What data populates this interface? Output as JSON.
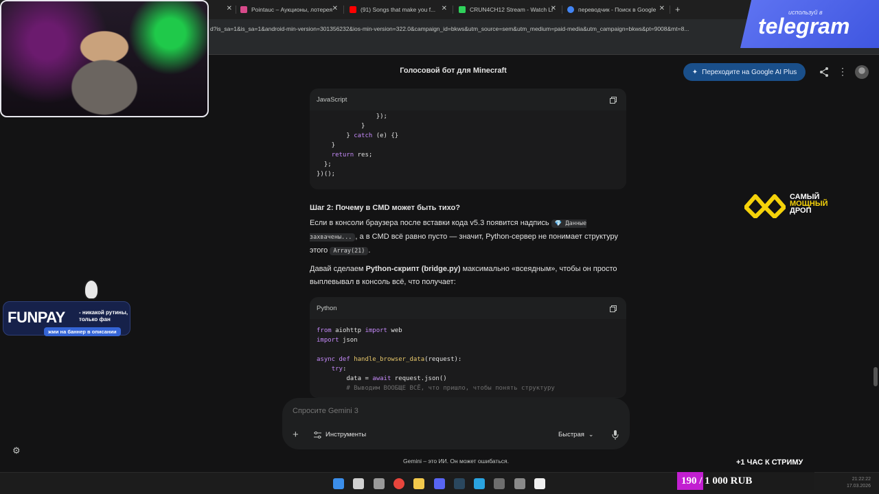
{
  "browser": {
    "tabs": [
      {
        "label": "",
        "color": "#3c3c3c"
      },
      {
        "label": "Pointauc – Аукционы, лотерея",
        "color": "#d84a8a"
      },
      {
        "label": "(91) Songs that make you f...",
        "color": "#ff0000"
      },
      {
        "label": "CRUN4CH12 Stream - Watch Li",
        "color": "#2fd15b"
      },
      {
        "label": "переводчик - Поиск в Google",
        "color": "#4285f4"
      }
    ],
    "url": "d?is_sa=1&is_sa=1&android-min-version=301356232&ios-min-version=322.0&campaign_id=bkws&utm_source=sem&utm_medium=paid-media&utm_campaign=bkws&pt=9008&mt=8..."
  },
  "header": {
    "title": "Голосовой бот для Minecraft",
    "upgrade_label": "Переходите на Google AI Plus"
  },
  "code1": {
    "lang": "JavaScript",
    "lines": [
      "                });",
      "            }",
      "        } catch (e) {}",
      "    }",
      "    return res;",
      "  };",
      "})();"
    ]
  },
  "answer": {
    "step_heading": "Шаг 2: Почему в CMD может быть тихо?",
    "p1_start": "Если в консоли браузера после вставки кода v5.3 появится надпись",
    "p1_code": "💎 Данные захвачены...",
    "p1_mid": ", а в CMD всё равно пусто — значит, Python-сервер не понимает структуру этого",
    "p1_code2": "Array(21)",
    "p1_end": ".",
    "p2_start": "Давай сделаем",
    "p2_bold": "Python-скрипт (bridge.py)",
    "p2_end": "максимально «всеядным», чтобы он просто выплевывал в консоль всё, что получает:"
  },
  "code2": {
    "lang": "Python",
    "lines": [
      "from aiohttp import web",
      "import json",
      "",
      "async def handle_browser_data(request):",
      "    try:",
      "        data = await request.json()",
      "        # Выводим ВООБЩЕ ВСЁ, что пришло, чтобы понять структуру"
    ]
  },
  "composer": {
    "placeholder": "Спросите Gemini 3",
    "tools_label": "Инструменты",
    "mode_label": "Быстрая"
  },
  "disclaimer": "Gemini – это ИИ. Он может ошибаться.",
  "overlays": {
    "telegram_small": "используй в",
    "telegram_big": "telegram",
    "drop_text": [
      "самый",
      "мощный",
      "дроп"
    ],
    "funpay_logo": "FUNPAY",
    "funpay_tag": "- никакой рутины, только фан",
    "funpay_cta": "жми на баннер в описании",
    "stream_timer": "+1 ЧАС К СТРИМУ",
    "donate_text": "190 / 1 000 RUB",
    "donate_progress": 0.19
  },
  "taskbar": {
    "clock_time": "21:22:22",
    "clock_date": "17.03.2026",
    "icons": [
      "windows-icon",
      "search-icon",
      "task-view-icon",
      "chrome-icon",
      "explorer-icon",
      "discord-icon",
      "steam-icon",
      "telegram-icon",
      "obs-icon",
      "settings-icon",
      "notepad-icon"
    ]
  }
}
